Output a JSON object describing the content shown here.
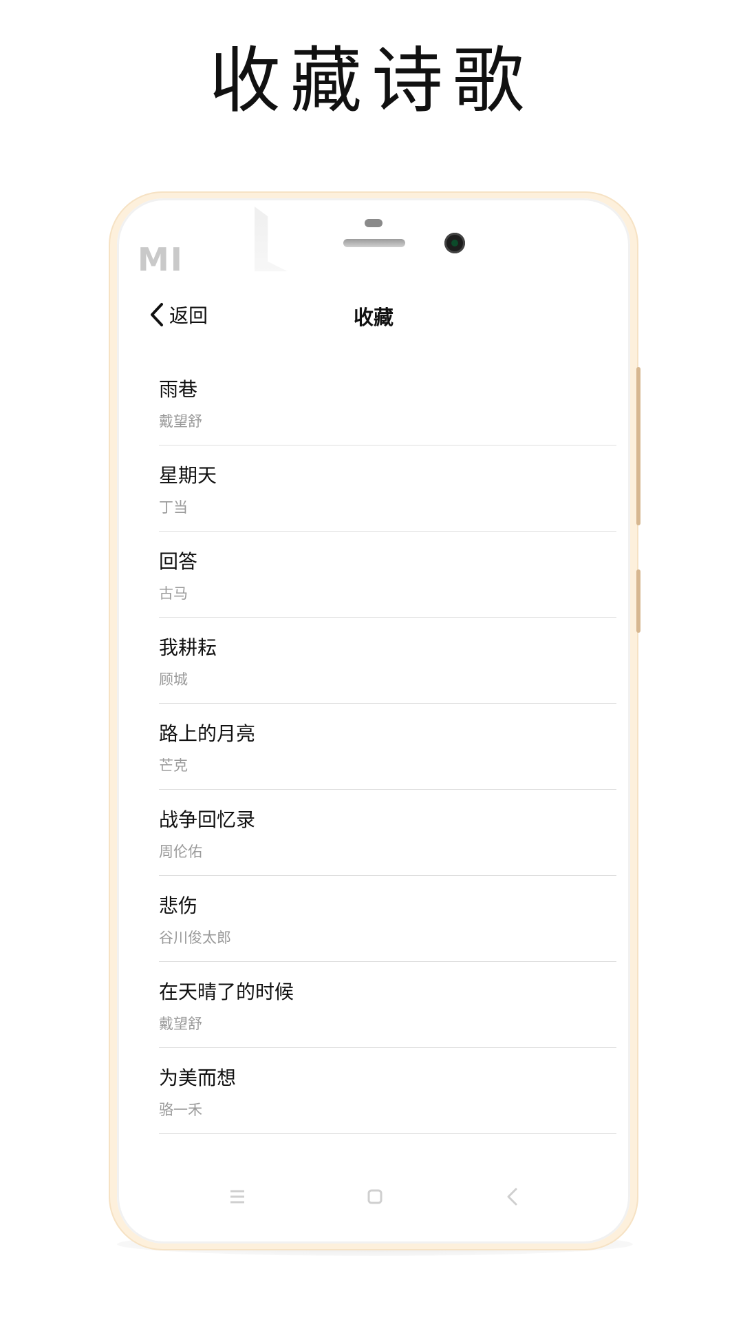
{
  "promo": {
    "title": "收藏诗歌"
  },
  "device": {
    "logo": "MI"
  },
  "header": {
    "back_label": "返回",
    "title": "收藏"
  },
  "poems": [
    {
      "title": "雨巷",
      "author": "戴望舒"
    },
    {
      "title": "星期天",
      "author": "丁当"
    },
    {
      "title": "回答",
      "author": "古马"
    },
    {
      "title": "我耕耘",
      "author": "顾城"
    },
    {
      "title": "路上的月亮",
      "author": "芒克"
    },
    {
      "title": "战争回忆录",
      "author": "周伦佑"
    },
    {
      "title": "悲伤",
      "author": "谷川俊太郎"
    },
    {
      "title": "在天晴了的时候",
      "author": "戴望舒"
    },
    {
      "title": "为美而想",
      "author": "骆一禾"
    }
  ],
  "system_nav": {
    "icons": [
      "menu-icon",
      "home-icon",
      "back-icon"
    ],
    "icon_color": "#cfcfcf"
  },
  "colors": {
    "frame": "#fdf0dc",
    "text_primary": "#111111",
    "text_secondary": "#9a9a9a",
    "divider": "#dedede"
  }
}
